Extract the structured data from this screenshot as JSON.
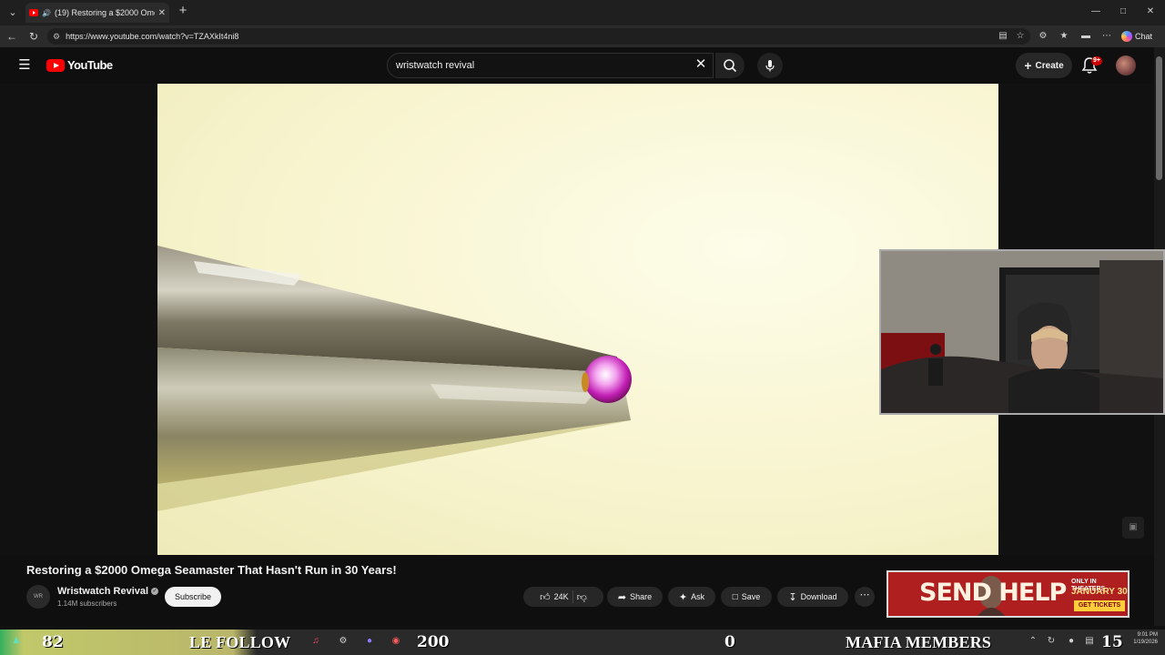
{
  "browser": {
    "tab_title": "(19) Restoring a $2000 Omeg",
    "url": "https://www.youtube.com/watch?v=TZAXkIt4ni8",
    "chat_label": "Chat"
  },
  "youtube": {
    "logo_text": "YouTube",
    "search_value": "wristwatch revival",
    "create_label": "Create",
    "notification_badge": "9+"
  },
  "video": {
    "title": "Restoring a $2000 Omega Seamaster That Hasn't Run in 30 Years!",
    "channel_name": "Wristwatch Revival",
    "channel_avatar_text": "WR",
    "subscribers": "1.14M subscribers",
    "subscribe_label": "Subscribe",
    "likes": "24K",
    "share_label": "Share",
    "ask_label": "Ask",
    "save_label": "Save",
    "download_label": "Download"
  },
  "ad": {
    "headline": "SEND HELP",
    "line1": "ONLY IN THEATERS",
    "line2": "JANUARY 30",
    "cta": "GET TICKETS"
  },
  "overlay": {
    "stat_left": "82",
    "follow_text": "LE FOLLOW",
    "stat_200": "200",
    "stat_zero": "0",
    "mafia_label": "MAFIA MEMBERS",
    "stat_right": "15"
  },
  "system": {
    "time": "9:01 PM",
    "date": "1/19/2026"
  },
  "colors": {
    "yt_red": "#ff0000",
    "background": "#0f0f0f",
    "ad_red": "#b01f1f"
  }
}
